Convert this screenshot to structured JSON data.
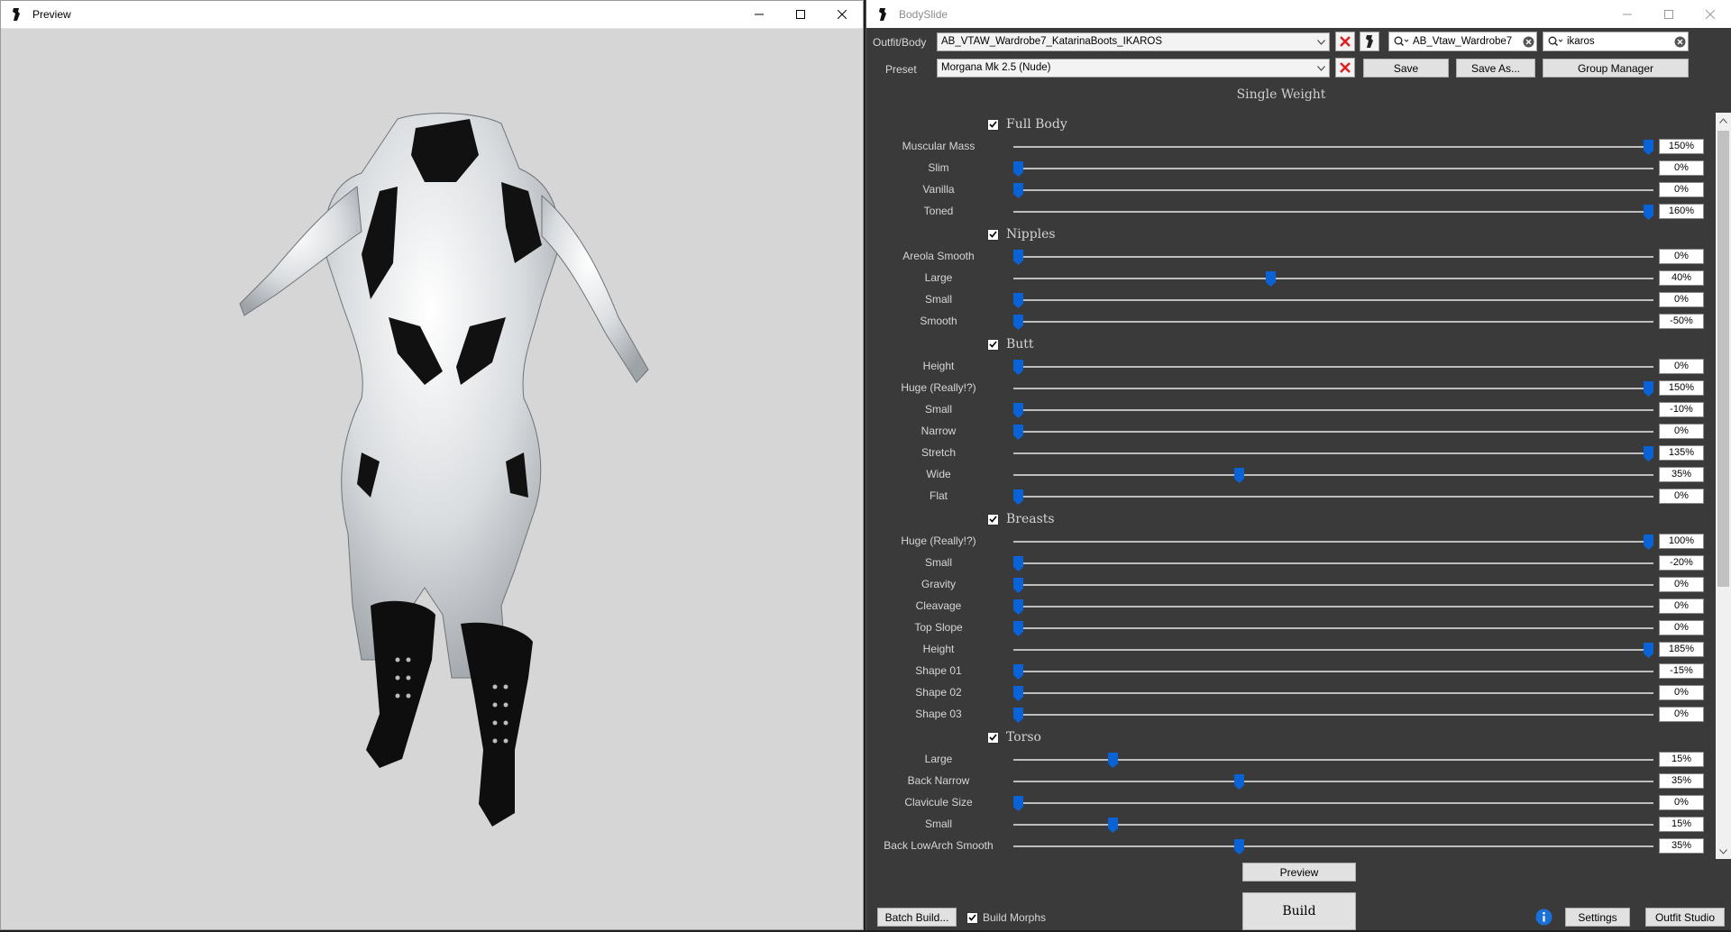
{
  "preview_window": {
    "title": "Preview"
  },
  "bodyslide_window": {
    "title": "BodySlide"
  },
  "outfit": {
    "label": "Outfit/Body",
    "value": "AB_VTAW_Wardrobe7_KatarinaBoots_IKAROS",
    "filter_value": "AB_Vtaw_Wardrobe7",
    "group_filter_value": "ikaros"
  },
  "preset": {
    "label": "Preset",
    "value": "Morgana Mk 2.5 (Nude)",
    "save_label": "Save",
    "save_as_label": "Save As...",
    "group_manager_label": "Group Manager"
  },
  "weight_mode": "Single Weight",
  "groups": [
    {
      "name": "Full Body",
      "checked": true,
      "sliders": [
        {
          "label": "Muscular Mass",
          "value": "150%",
          "level": 1.0
        },
        {
          "label": "Slim",
          "value": "0%",
          "level": 0.0
        },
        {
          "label": "Vanilla",
          "value": "0%",
          "level": 0.0
        },
        {
          "label": "Toned",
          "value": "160%",
          "level": 1.0
        }
      ]
    },
    {
      "name": "Nipples",
      "checked": true,
      "sliders": [
        {
          "label": "Areola Smooth",
          "value": "0%",
          "level": 0.0
        },
        {
          "label": "Large",
          "value": "40%",
          "level": 0.4
        },
        {
          "label": "Small",
          "value": "0%",
          "level": 0.0
        },
        {
          "label": "Smooth",
          "value": "-50%",
          "level": 0.0
        }
      ]
    },
    {
      "name": "Butt",
      "checked": true,
      "sliders": [
        {
          "label": "Height",
          "value": "0%",
          "level": 0.0
        },
        {
          "label": "Huge (Really!?)",
          "value": "150%",
          "level": 1.0
        },
        {
          "label": "Small",
          "value": "-10%",
          "level": 0.0
        },
        {
          "label": "Narrow",
          "value": "0%",
          "level": 0.0
        },
        {
          "label": "Stretch",
          "value": "135%",
          "level": 1.0
        },
        {
          "label": "Wide",
          "value": "35%",
          "level": 0.35
        },
        {
          "label": "Flat",
          "value": "0%",
          "level": 0.0
        }
      ]
    },
    {
      "name": "Breasts",
      "checked": true,
      "sliders": [
        {
          "label": "Huge (Really!?)",
          "value": "100%",
          "level": 1.0
        },
        {
          "label": "Small",
          "value": "-20%",
          "level": 0.0
        },
        {
          "label": "Gravity",
          "value": "0%",
          "level": 0.0
        },
        {
          "label": "Cleavage",
          "value": "0%",
          "level": 0.0
        },
        {
          "label": "Top Slope",
          "value": "0%",
          "level": 0.0
        },
        {
          "label": "Height",
          "value": "185%",
          "level": 1.0
        },
        {
          "label": "Shape 01",
          "value": "-15%",
          "level": 0.0
        },
        {
          "label": "Shape 02",
          "value": "0%",
          "level": 0.0
        },
        {
          "label": "Shape 03",
          "value": "0%",
          "level": 0.0
        }
      ]
    },
    {
      "name": "Torso",
      "checked": true,
      "sliders": [
        {
          "label": "Large",
          "value": "15%",
          "level": 0.15
        },
        {
          "label": "Back Narrow",
          "value": "35%",
          "level": 0.35
        },
        {
          "label": "Clavicule Size",
          "value": "0%",
          "level": 0.0
        },
        {
          "label": "Small",
          "value": "15%",
          "level": 0.15
        },
        {
          "label": "Back LowArch Smooth",
          "value": "35%",
          "level": 0.35
        }
      ]
    }
  ],
  "bottom": {
    "preview_label": "Preview",
    "build_label": "Build",
    "batch_build_label": "Batch Build...",
    "build_morphs_label": "Build Morphs",
    "build_morphs_checked": true,
    "settings_label": "Settings",
    "outfit_studio_label": "Outfit Studio"
  },
  "colors": {
    "accent": "#0a63d6",
    "remove_red": "#e02020",
    "panel_bg": "#3a3a3a",
    "preview_bg": "#d6d6d6"
  },
  "icons": [
    "app-icon",
    "minimize-icon",
    "maximize-icon",
    "close-icon",
    "remove-x-icon",
    "outfit-studio-icon",
    "search-icon",
    "clear-icon",
    "checkbox-icon",
    "info-icon",
    "dropdown-arrow-icon"
  ]
}
